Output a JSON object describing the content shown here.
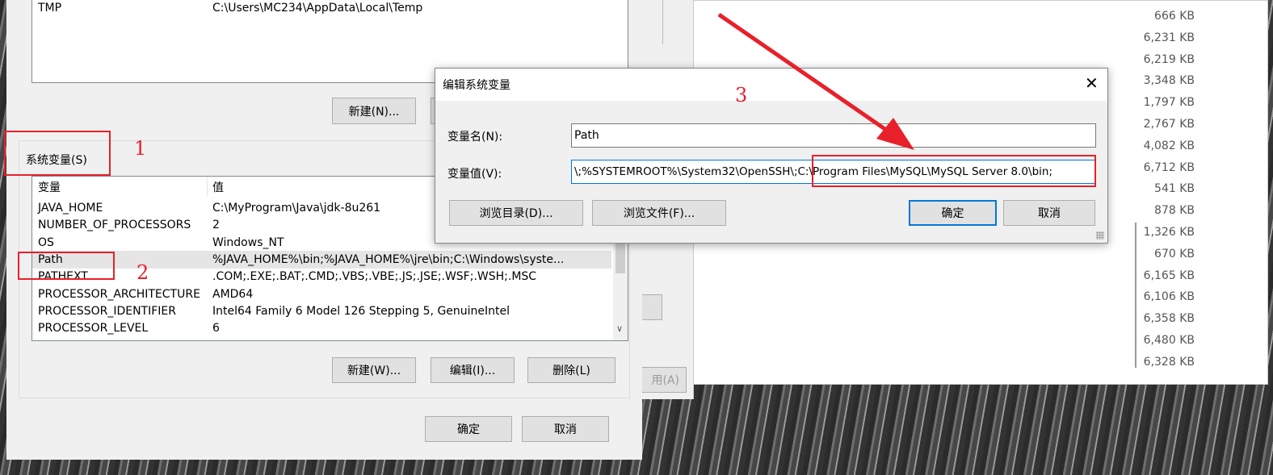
{
  "env_dialog": {
    "user_vars": [
      {
        "name": "TMP",
        "value": "C:\\Users\\MC234\\AppData\\Local\\Temp"
      }
    ],
    "user_new_button": "新建(N)...",
    "system_group_label": "系统变量(S)",
    "columns": [
      "变量",
      "值"
    ],
    "system_vars": [
      {
        "name": "JAVA_HOME",
        "value": "C:\\MyProgram\\Java\\jdk-8u261"
      },
      {
        "name": "NUMBER_OF_PROCESSORS",
        "value": "2"
      },
      {
        "name": "OS",
        "value": "Windows_NT"
      },
      {
        "name": "Path",
        "value": "%JAVA_HOME%\\bin;%JAVA_HOME%\\jre\\bin;C:\\Windows\\syste..."
      },
      {
        "name": "PATHEXT",
        "value": ".COM;.EXE;.BAT;.CMD;.VBS;.VBE;.JS;.JSE;.WSF;.WSH;.MSC"
      },
      {
        "name": "PROCESSOR_ARCHITECTURE",
        "value": "AMD64"
      },
      {
        "name": "PROCESSOR_IDENTIFIER",
        "value": "Intel64 Family 6 Model 126 Stepping 5, GenuineIntel"
      },
      {
        "name": "PROCESSOR_LEVEL",
        "value": "6"
      }
    ],
    "new_button": "新建(W)...",
    "edit_button": "编辑(I)...",
    "delete_button": "删除(L)",
    "ok_button": "确定",
    "cancel_button": "取消"
  },
  "middle_window": {
    "apply_button": "用(A)"
  },
  "edit_dialog": {
    "title": "编辑系统变量",
    "name_label": "变量名(N):",
    "name_value": "Path",
    "value_label": "变量值(V):",
    "value_value": "\\;%SYSTEMROOT%\\System32\\OpenSSH\\;C:\\Program Files\\MySQL\\MySQL Server 8.0\\bin;",
    "browse_dir_button": "浏览目录(D)...",
    "browse_file_button": "浏览文件(F)...",
    "ok_button": "确定",
    "cancel_button": "取消",
    "close_icon": "close-icon"
  },
  "file_sizes": [
    "666 KB",
    "6,231 KB",
    "6,219 KB",
    "3,348 KB",
    "1,797 KB",
    "2,767 KB",
    "4,082 KB",
    "6,712 KB",
    "541 KB",
    "878 KB",
    "1,326 KB",
    "670 KB",
    "6,165 KB",
    "6,106 KB",
    "6,358 KB",
    "6,480 KB",
    "6,328 KB"
  ],
  "annotations": {
    "one": "1",
    "two": "2",
    "three": "3",
    "color": "#e8202a"
  }
}
